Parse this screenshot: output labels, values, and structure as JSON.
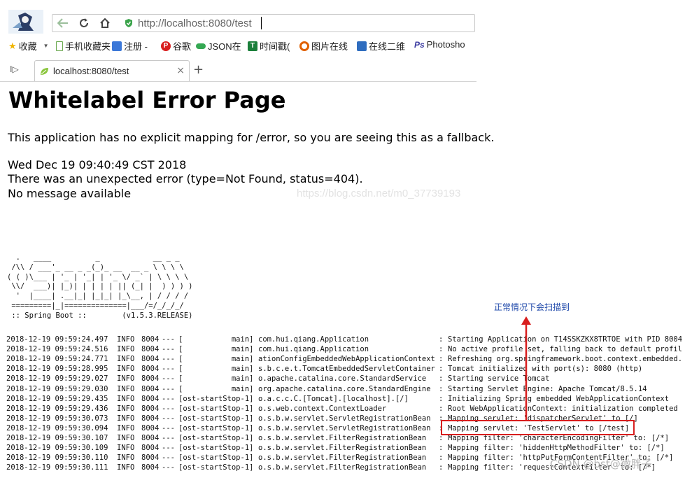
{
  "browser": {
    "url_host": "http://localhost",
    "url_rest": ":8080/test",
    "bookmarks": [
      {
        "label": "收藏",
        "icon": "star-icon",
        "color": "#f0b400"
      },
      {
        "label": "手机收藏夹",
        "icon": "phone-icon",
        "color": "#6aa84f"
      },
      {
        "label": "注册 -",
        "icon": "register-icon",
        "color": "#3c78d8"
      },
      {
        "label": "谷歌",
        "icon": "pinterest-icon",
        "color": "#d81e1e"
      },
      {
        "label": "JSON在",
        "icon": "json-icon",
        "color": "#35a853"
      },
      {
        "label": "时间戳(",
        "icon": "timestamp-icon",
        "color": "#1b7f3b"
      },
      {
        "label": "图片在线",
        "icon": "image-icon",
        "color": "#e06000"
      },
      {
        "label": "在线二维",
        "icon": "qrcode-icon",
        "color": "#2f6dbf"
      },
      {
        "label": "Photosho",
        "icon": "photoshop-icon",
        "color": "#3a3aa0"
      }
    ],
    "tab_title": "localhost:8080/test"
  },
  "page": {
    "title": "Whitelabel Error Page",
    "line1": "This application has no explicit mapping for /error, so you are seeing this as a fallback.",
    "line2": "Wed Dec 19 09:40:49 CST 2018",
    "line3": "There was an unexpected error (type=Not Found, status=404).",
    "line4": "No message available",
    "watermark": "https://blog.csdn.net/m0_37739193"
  },
  "console": {
    "banner": "  .   ____          _            __ _ _\n /\\\\ / ___'_ __ _ _(_)_ __  __ _ \\ \\ \\ \\\n( ( )\\___ | '_ | '_| | '_ \\/ _` | \\ \\ \\ \\\n \\\\/  ___)| |_)| | | | | || (_| |  ) ) ) )\n  '  |____| .__|_| |_|_| |_\\__, | / / / /\n =========|_|==============|___/=/_/_/_/\n :: Spring Boot ::        (v1.5.3.RELEASE)",
    "rows": [
      {
        "ts": "2018-12-19 09:59:24.497",
        "level": "INFO",
        "pid": "8004",
        "dash": "---",
        "thread": "[           main]",
        "logger": "com.hui.qiang.Application",
        "msg": "Starting Application on T14SSKZKX8TRTOE with PID 8004"
      },
      {
        "ts": "2018-12-19 09:59:24.516",
        "level": "INFO",
        "pid": "8004",
        "dash": "---",
        "thread": "[           main]",
        "logger": "com.hui.qiang.Application",
        "msg": "No active profile set, falling back to default profil"
      },
      {
        "ts": "2018-12-19 09:59:24.771",
        "level": "INFO",
        "pid": "8004",
        "dash": "---",
        "thread": "[           main]",
        "logger": "ationConfigEmbeddedWebApplicationContext",
        "msg": "Refreshing org.springframework.boot.context.embedded."
      },
      {
        "ts": "2018-12-19 09:59:28.995",
        "level": "INFO",
        "pid": "8004",
        "dash": "---",
        "thread": "[           main]",
        "logger": "s.b.c.e.t.TomcatEmbeddedServletContainer",
        "msg": "Tomcat initialized with port(s): 8080 (http)"
      },
      {
        "ts": "2018-12-19 09:59:29.027",
        "level": "INFO",
        "pid": "8004",
        "dash": "---",
        "thread": "[           main]",
        "logger": "o.apache.catalina.core.StandardService",
        "msg": "Starting service Tomcat"
      },
      {
        "ts": "2018-12-19 09:59:29.030",
        "level": "INFO",
        "pid": "8004",
        "dash": "---",
        "thread": "[           main]",
        "logger": "org.apache.catalina.core.StandardEngine",
        "msg": "Starting Servlet Engine: Apache Tomcat/8.5.14"
      },
      {
        "ts": "2018-12-19 09:59:29.435",
        "level": "INFO",
        "pid": "8004",
        "dash": "---",
        "thread": "[ost-startStop-1]",
        "logger": "o.a.c.c.C.[Tomcat].[localhost].[/]",
        "msg": "Initializing Spring embedded WebApplicationContext"
      },
      {
        "ts": "2018-12-19 09:59:29.436",
        "level": "INFO",
        "pid": "8004",
        "dash": "---",
        "thread": "[ost-startStop-1]",
        "logger": "o.s.web.context.ContextLoader",
        "msg": "Root WebApplicationContext: initialization completed"
      },
      {
        "ts": "2018-12-19 09:59:30.073",
        "level": "INFO",
        "pid": "8004",
        "dash": "---",
        "thread": "[ost-startStop-1]",
        "logger": "o.s.b.w.servlet.ServletRegistrationBean",
        "msg": "Mapping servlet: 'dispatcherServlet' to [/]"
      },
      {
        "ts": "2018-12-19 09:59:30.094",
        "level": "INFO",
        "pid": "8004",
        "dash": "---",
        "thread": "[ost-startStop-1]",
        "logger": "o.s.b.w.servlet.ServletRegistrationBean",
        "msg": "Mapping servlet: 'TestServlet' to [/test]"
      },
      {
        "ts": "2018-12-19 09:59:30.107",
        "level": "INFO",
        "pid": "8004",
        "dash": "---",
        "thread": "[ost-startStop-1]",
        "logger": "o.s.b.w.servlet.FilterRegistrationBean",
        "msg": "Mapping filter: 'characterEncodingFilter' to: [/*]"
      },
      {
        "ts": "2018-12-19 09:59:30.109",
        "level": "INFO",
        "pid": "8004",
        "dash": "---",
        "thread": "[ost-startStop-1]",
        "logger": "o.s.b.w.servlet.FilterRegistrationBean",
        "msg": "Mapping filter: 'hiddenHttpMethodFilter' to: [/*]"
      },
      {
        "ts": "2018-12-19 09:59:30.110",
        "level": "INFO",
        "pid": "8004",
        "dash": "---",
        "thread": "[ost-startStop-1]",
        "logger": "o.s.b.w.servlet.FilterRegistrationBean",
        "msg": "Mapping filter: 'httpPutFormContentFilter' to: [/*]"
      },
      {
        "ts": "2018-12-19 09:59:30.111",
        "level": "INFO",
        "pid": "8004",
        "dash": "---",
        "thread": "[ost-startStop-1]",
        "logger": "o.s.b.w.servlet.FilterRegistrationBean",
        "msg": "Mapping filter: 'requestContextFilter' to: [/*]"
      }
    ]
  },
  "annotation": {
    "text": "正常情况下会扫描到",
    "highlight_color": "#d81e1e",
    "text_color": "#1a44a8"
  },
  "footer_watermark": "CSDN @bst@微胖子"
}
